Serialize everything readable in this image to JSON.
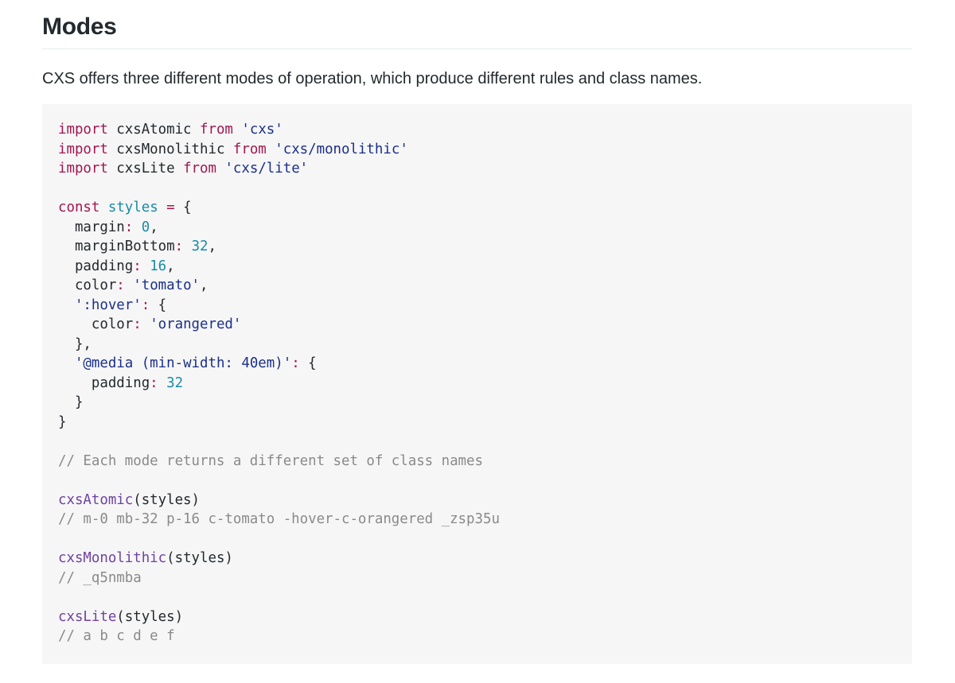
{
  "heading": "Modes",
  "intro": "CXS offers three different modes of operation, which produce different rules and class names.",
  "code_lines": [
    [
      {
        "t": "import",
        "c": "kw"
      },
      {
        "t": " cxsAtomic ",
        "c": ""
      },
      {
        "t": "from",
        "c": "kw"
      },
      {
        "t": " ",
        "c": ""
      },
      {
        "t": "'cxs'",
        "c": "str"
      }
    ],
    [
      {
        "t": "import",
        "c": "kw"
      },
      {
        "t": " cxsMonolithic ",
        "c": ""
      },
      {
        "t": "from",
        "c": "kw"
      },
      {
        "t": " ",
        "c": ""
      },
      {
        "t": "'cxs/monolithic'",
        "c": "str"
      }
    ],
    [
      {
        "t": "import",
        "c": "kw"
      },
      {
        "t": " cxsLite ",
        "c": ""
      },
      {
        "t": "from",
        "c": "kw"
      },
      {
        "t": " ",
        "c": ""
      },
      {
        "t": "'cxs/lite'",
        "c": "str"
      }
    ],
    [],
    [
      {
        "t": "const",
        "c": "kw"
      },
      {
        "t": " ",
        "c": ""
      },
      {
        "t": "styles",
        "c": "var"
      },
      {
        "t": " ",
        "c": ""
      },
      {
        "t": "=",
        "c": "op"
      },
      {
        "t": " {",
        "c": ""
      }
    ],
    [
      {
        "t": "  margin",
        "c": ""
      },
      {
        "t": ":",
        "c": "op"
      },
      {
        "t": " ",
        "c": ""
      },
      {
        "t": "0",
        "c": "num"
      },
      {
        "t": ",",
        "c": ""
      }
    ],
    [
      {
        "t": "  marginBottom",
        "c": ""
      },
      {
        "t": ":",
        "c": "op"
      },
      {
        "t": " ",
        "c": ""
      },
      {
        "t": "32",
        "c": "num"
      },
      {
        "t": ",",
        "c": ""
      }
    ],
    [
      {
        "t": "  padding",
        "c": ""
      },
      {
        "t": ":",
        "c": "op"
      },
      {
        "t": " ",
        "c": ""
      },
      {
        "t": "16",
        "c": "num"
      },
      {
        "t": ",",
        "c": ""
      }
    ],
    [
      {
        "t": "  color",
        "c": ""
      },
      {
        "t": ":",
        "c": "op"
      },
      {
        "t": " ",
        "c": ""
      },
      {
        "t": "'tomato'",
        "c": "str"
      },
      {
        "t": ",",
        "c": ""
      }
    ],
    [
      {
        "t": "  ",
        "c": ""
      },
      {
        "t": "':hover'",
        "c": "str"
      },
      {
        "t": ":",
        "c": "op"
      },
      {
        "t": " {",
        "c": ""
      }
    ],
    [
      {
        "t": "    color",
        "c": ""
      },
      {
        "t": ":",
        "c": "op"
      },
      {
        "t": " ",
        "c": ""
      },
      {
        "t": "'orangered'",
        "c": "str"
      }
    ],
    [
      {
        "t": "  },",
        "c": ""
      }
    ],
    [
      {
        "t": "  ",
        "c": ""
      },
      {
        "t": "'@media (min-width: 40em)'",
        "c": "str"
      },
      {
        "t": ":",
        "c": "op"
      },
      {
        "t": " {",
        "c": ""
      }
    ],
    [
      {
        "t": "    padding",
        "c": ""
      },
      {
        "t": ":",
        "c": "op"
      },
      {
        "t": " ",
        "c": ""
      },
      {
        "t": "32",
        "c": "num"
      }
    ],
    [
      {
        "t": "  }",
        "c": ""
      }
    ],
    [
      {
        "t": "}",
        "c": ""
      }
    ],
    [],
    [
      {
        "t": "// Each mode returns a different set of class names",
        "c": "cmt"
      }
    ],
    [],
    [
      {
        "t": "cxsAtomic",
        "c": "fn"
      },
      {
        "t": "(styles)",
        "c": ""
      }
    ],
    [
      {
        "t": "// m-0 mb-32 p-16 c-tomato -hover-c-orangered _zsp35u",
        "c": "cmt"
      }
    ],
    [],
    [
      {
        "t": "cxsMonolithic",
        "c": "fn"
      },
      {
        "t": "(styles)",
        "c": ""
      }
    ],
    [
      {
        "t": "// _q5nmba",
        "c": "cmt"
      }
    ],
    [],
    [
      {
        "t": "cxsLite",
        "c": "fn"
      },
      {
        "t": "(styles)",
        "c": ""
      }
    ],
    [
      {
        "t": "// a b c d e f",
        "c": "cmt"
      }
    ]
  ],
  "colors": {
    "keyword": "#a11750",
    "string": "#1b2f8a",
    "number": "#1a8ba6",
    "function": "#6f42a1",
    "comment": "#8a8a8a",
    "code_background": "#f6f6f6"
  }
}
